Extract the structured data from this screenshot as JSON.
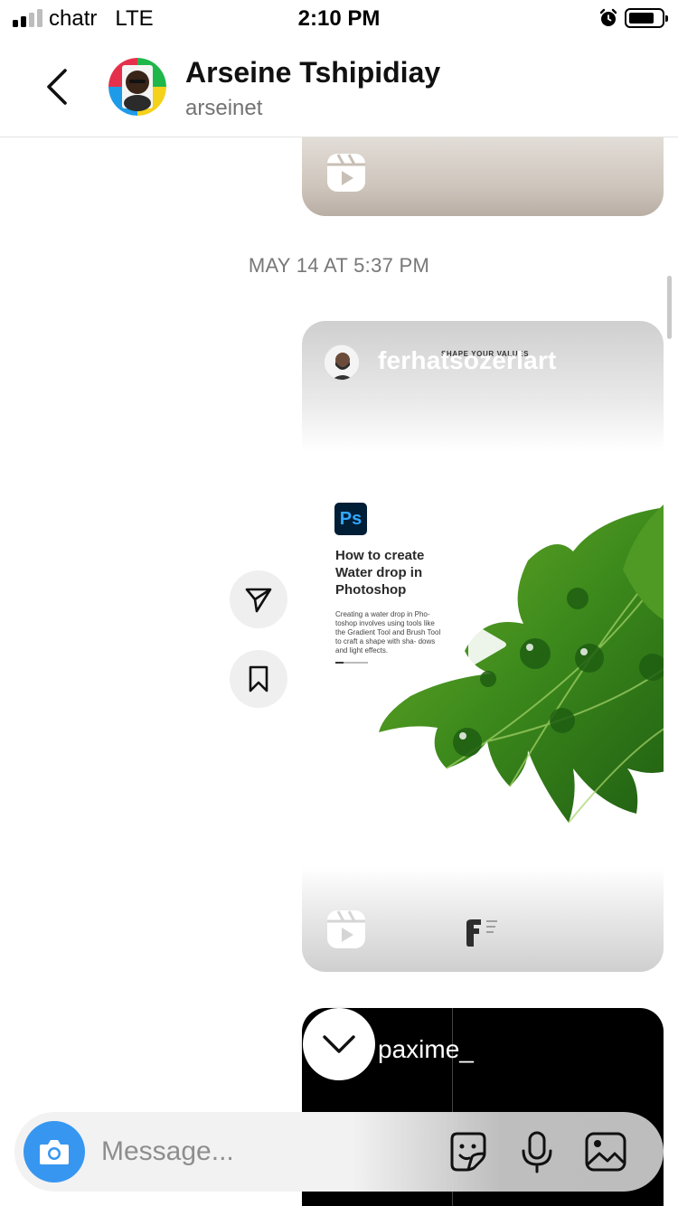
{
  "status_bar": {
    "carrier": "chatr",
    "network": "LTE",
    "time": "2:10 PM",
    "signal_bars": 4,
    "signal_bars_filled": 2,
    "battery_level": 0.7
  },
  "header": {
    "back_icon": "chevron-left-icon",
    "display_name": "Arseine Tshipidiay",
    "username": "arseinet"
  },
  "thread": {
    "timestamp": "MAY 14 AT 5:37 PM",
    "shared_post": {
      "username": "ferhatsozerlart",
      "overlay_text": "SHAPE YOUR VALUES",
      "app_badge": "Ps",
      "title": "How to create Water drop in Photoshop",
      "description": "Creating a water drop in Pho- toshop involves using tools like the Gradient Tool and Brush Tool to craft a shape with sha- dows and light effects."
    },
    "next_post": {
      "username": "paxime_"
    },
    "actions": {
      "share_icon": "paper-plane-icon",
      "save_icon": "bookmark-icon"
    }
  },
  "composer": {
    "placeholder": "Message...",
    "camera_icon": "camera-icon",
    "sticker_icon": "sticker-icon",
    "mic_icon": "microphone-icon",
    "gallery_icon": "image-icon"
  },
  "colors": {
    "accent": "#3797f0",
    "photoshop_bg": "#001e36",
    "photoshop_fg": "#31a8ff"
  }
}
